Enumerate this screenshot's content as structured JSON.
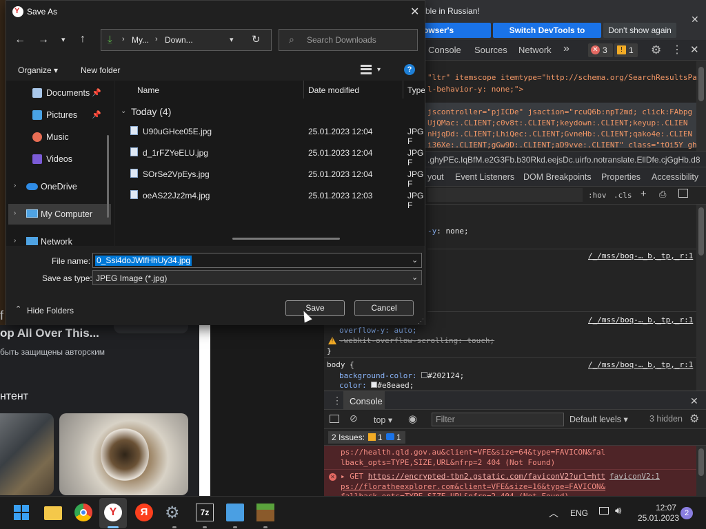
{
  "browser_page": {
    "heading": "op All Over This...",
    "copyright_text": "быть защищены авторским",
    "subheading": "нтент",
    "partial_f": "f"
  },
  "infobar": {
    "text_fragment": "ble in Russian!",
    "btn_browser_language": "owser's language",
    "btn_switch_devtools": "Switch DevTools to Russian",
    "btn_dont_show": "Don't show again"
  },
  "devtools": {
    "tabs": [
      "Console",
      "Sources",
      "Network"
    ],
    "more_tabs": "»",
    "error_count": "3",
    "warning_count": "1",
    "elements_lines": [
      "\"ltr\" itemscope itemtype=\"http://schema.org/SearchResultsPa",
      "l-behavior-y: none;\">",
      "",
      "jscontroller=\"pjICDe\" jsaction=\"rcuQ6b:npT2md; click:FAbpg",
      "UjQMac:.CLIENT;c0v8t:.CLIENT;keydown:.CLIENT;keyup:.CLIEN",
      "nHjqDd:.CLIENT;LhiQec:.CLIENT;GvneHb:.CLIENT;qako4e:.CLIEN",
      "i36Xe:.CLIENT;gGw9D:.CLIENT;aD9vve:.CLIENT\" class=\"tOi5Y gh"
    ],
    "breadcrumb": ".ghyPEc.IqBfM.e2G3Fb.b30Rkd.eejsDc.uirfo.notranslate.EllDfe.cjGgHb.d8",
    "sub_tabs": [
      "yout",
      "Event Listeners",
      "DOM Breakpoints",
      "Properties",
      "Accessibility"
    ],
    "hov": ":hov",
    "cls": ".cls",
    "styles_line1": "-y: none;",
    "style_source_1": "/_/mss/boq-…_b,_tp,_r:1",
    "style_source_2": "/_/mss/boq-…_b,_tp,_r:1",
    "style_source_3": "/_/mss/boq-…_b,_tp,_r:1",
    "rule_overflow_y": "overflow-y: auto;",
    "rule_webkit": "-webkit-overflow-scrolling: touch;",
    "rule_close": "}",
    "body_selector": "body {",
    "body_bg_prop": "background-color:",
    "body_bg_val": "#202124;",
    "body_color_prop": "color:",
    "body_color_val": "#e8eaed;",
    "drawer_title": "Console",
    "context": "top",
    "filter_placeholder": "Filter",
    "default_levels": "Default levels",
    "hidden_count": "3 hidden",
    "issues_label": "2 Issues:",
    "issues_warn": "1",
    "issues_info": "1",
    "console_line1": "ps://health.qld.gov.au&client=VFE&size=64&type=FAVICON&fal",
    "console_line2": "lback_opts=TYPE,SIZE,URL&nfrp=2",
    "console_line2_status": "404 (Not Found)",
    "console_get": "GET",
    "console_url": "https://encrypted-tbn2.gstatic.com/faviconV2?url=htt",
    "console_source": "faviconV2:1",
    "console_line4": "ps://floratheexplorer.com&client=VFE&size=16&type=FAVICON&",
    "console_line5": "fallback_opts=TYPE,SIZE,URL&nfrp=2 404 (Not Found)"
  },
  "dialog": {
    "title": "Save As",
    "breadcrumb": [
      "My...",
      "Down..."
    ],
    "search_placeholder": "Search Downloads",
    "organize": "Organize",
    "new_folder": "New folder",
    "nav_items": [
      {
        "label": "Documents",
        "icon": "documents-icon",
        "pinned": true
      },
      {
        "label": "Pictures",
        "icon": "pictures-icon",
        "pinned": true
      },
      {
        "label": "Music",
        "icon": "music-icon",
        "pinned": false
      },
      {
        "label": "Videos",
        "icon": "videos-icon",
        "pinned": false
      },
      {
        "label": "OneDrive",
        "icon": "onedrive-icon",
        "pinned": false
      },
      {
        "label": "My Computer",
        "icon": "computer-icon",
        "pinned": false
      },
      {
        "label": "Network",
        "icon": "network-icon",
        "pinned": false
      }
    ],
    "columns": [
      "Name",
      "Date modified",
      "Type"
    ],
    "group_label": "Today (4)",
    "files": [
      {
        "name": "U90uGHce05E.jpg",
        "date": "25.01.2023 12:04",
        "type": "JPG F"
      },
      {
        "name": "d_1rFZYeELU.jpg",
        "date": "25.01.2023 12:04",
        "type": "JPG F"
      },
      {
        "name": "SOrSe2VpEys.jpg",
        "date": "25.01.2023 12:04",
        "type": "JPG F"
      },
      {
        "name": "oeAS22Jz2m4.jpg",
        "date": "25.01.2023 12:03",
        "type": "JPG F"
      }
    ],
    "file_name_label": "File name:",
    "file_name_value": "0_Ssi4doJWlfHhUy34.jpg",
    "save_type_label": "Save as type:",
    "save_type_value": "JPEG Image (*.jpg)",
    "hide_folders": "Hide Folders",
    "save": "Save",
    "cancel": "Cancel"
  },
  "taskbar": {
    "language": "ENG",
    "time": "12:07",
    "date": "25.01.2023",
    "notifications": "2"
  }
}
